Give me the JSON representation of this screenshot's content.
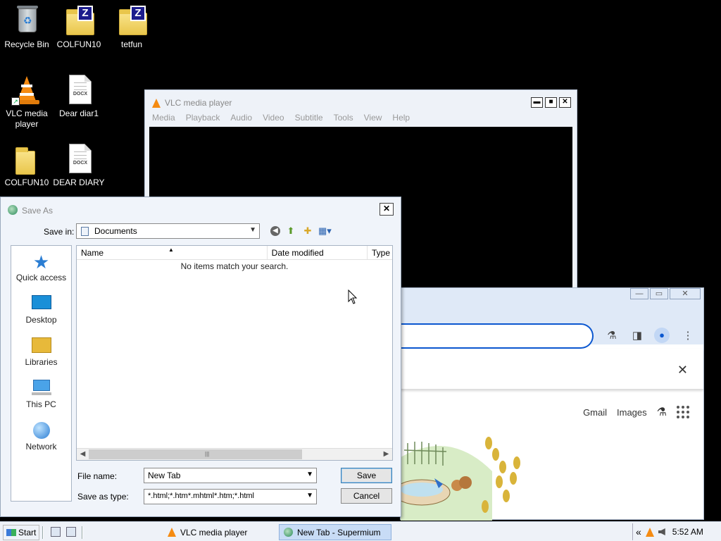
{
  "desktop": {
    "icons": [
      {
        "label": "Recycle Bin",
        "icon": "recycle-bin-icon"
      },
      {
        "label": "COLFUN10",
        "icon": "folder-zip-icon"
      },
      {
        "label": "tetfun",
        "icon": "folder-zip-icon"
      },
      {
        "label": "VLC media player",
        "icon": "vlc-icon"
      },
      {
        "label": "Dear diar1",
        "icon": "docx-icon"
      },
      {
        "label": "COLFUN10",
        "icon": "folder-icon"
      },
      {
        "label": "DEAR DIARY",
        "icon": "docx-icon"
      }
    ]
  },
  "vlc": {
    "title": "VLC media player",
    "menu": [
      "Media",
      "Playback",
      "Audio",
      "Video",
      "Subtitle",
      "Tools",
      "View",
      "Help"
    ],
    "buttons": {
      "minimize": "▬",
      "maximize": "■",
      "close": "✕"
    }
  },
  "browser": {
    "close_glyph": "✕",
    "links": {
      "gmail": "Gmail",
      "images": "Images"
    }
  },
  "dialog": {
    "title": "Save As",
    "save_in_label": "Save in:",
    "save_in_value": "Documents",
    "places": [
      "Quick access",
      "Desktop",
      "Libraries",
      "This PC",
      "Network"
    ],
    "columns": {
      "name": "Name",
      "date": "Date modified",
      "type": "Type"
    },
    "empty_message": "No items match your search.",
    "file_name_label": "File name:",
    "file_name_value": "New Tab",
    "save_type_label": "Save as type:",
    "save_type_value": "*.html;*.htm*.mhtml*.htm;*.html",
    "save_button": "Save",
    "cancel_button": "Cancel"
  },
  "taskbar": {
    "start": "Start",
    "tasks": [
      {
        "label": "VLC media player",
        "active": false
      },
      {
        "label": "New Tab - Supermium",
        "active": true
      }
    ],
    "tray_chevron": "«",
    "clock": "5:52 AM"
  },
  "colors": {
    "accent": "#0b57d0",
    "vlc_orange": "#f58b12",
    "desktop": "#000000"
  }
}
